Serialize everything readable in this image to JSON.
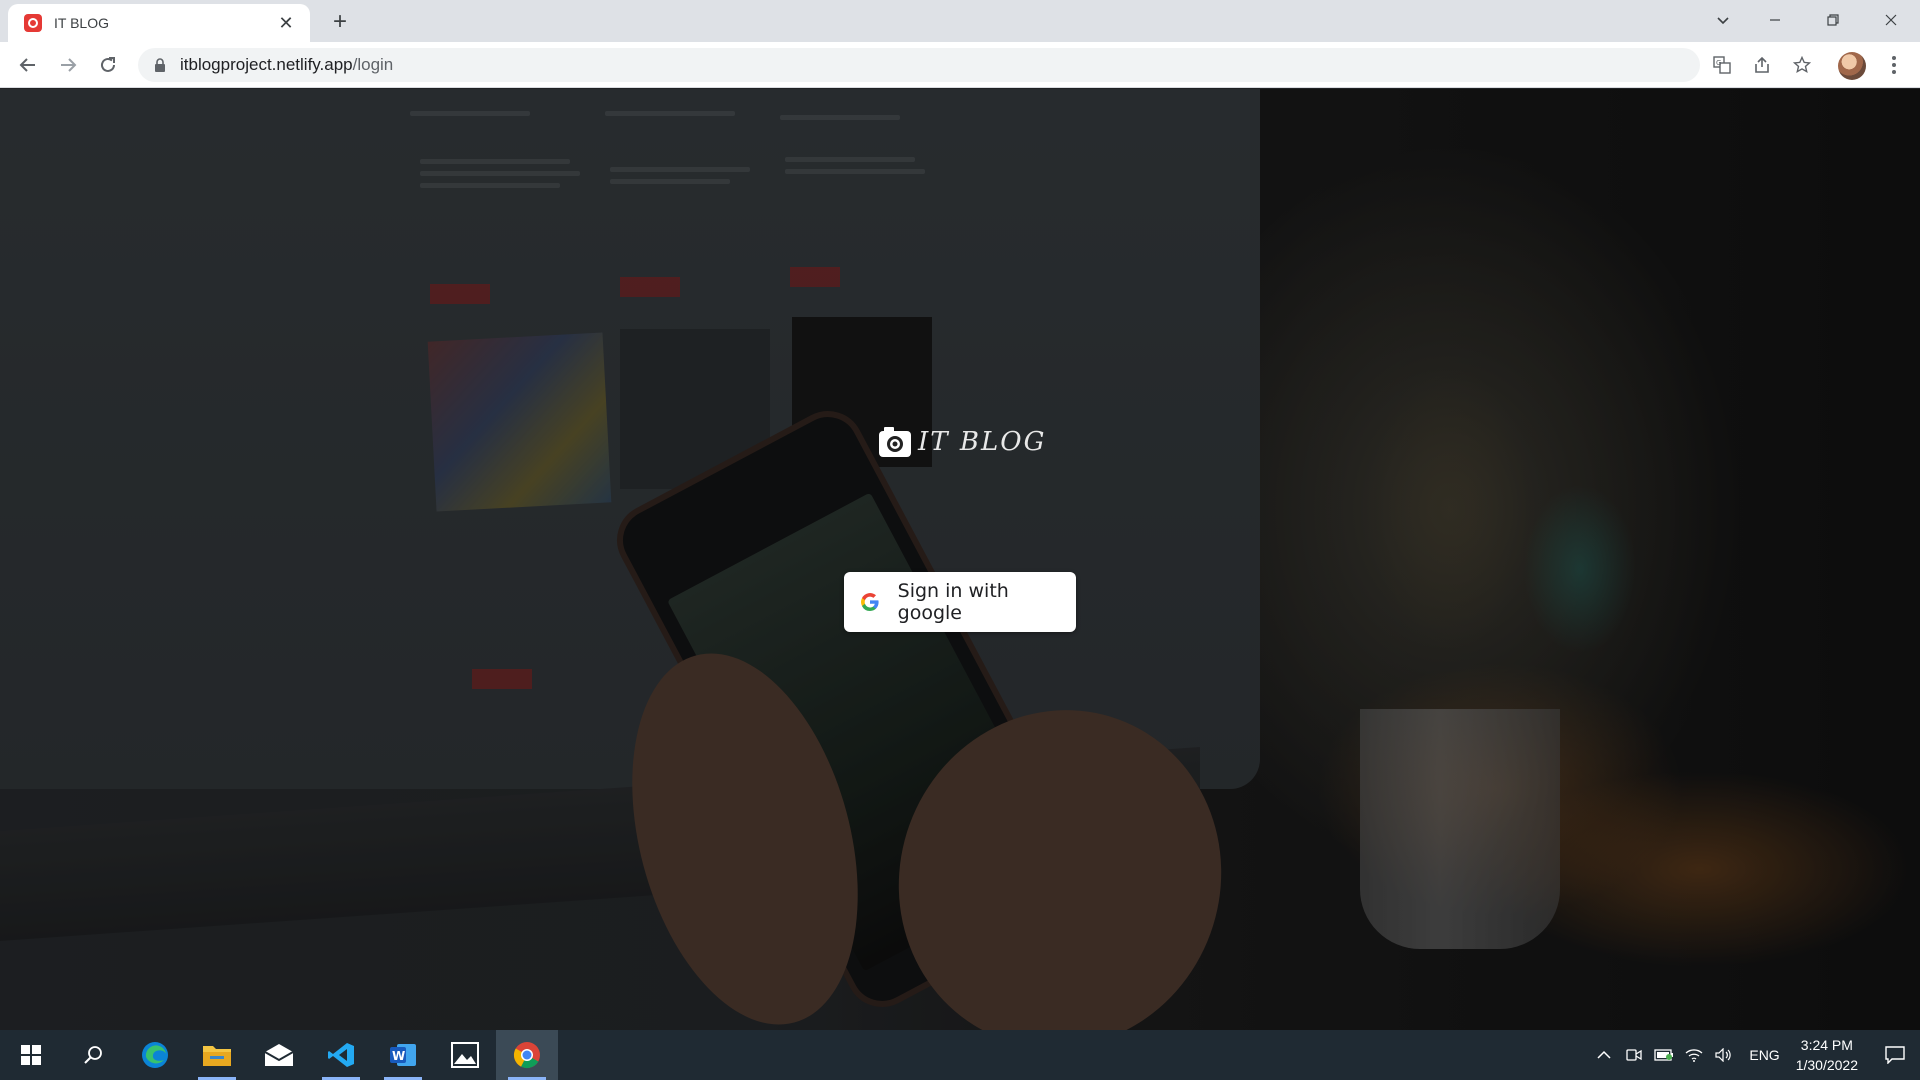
{
  "browser": {
    "tab": {
      "title": "IT BLOG",
      "favicon": "camera-icon"
    },
    "url": {
      "host": "itblogproject.netlify.app",
      "path": "/login"
    }
  },
  "page": {
    "brand_name": "IT BLOG",
    "signin_label": "Sign in with google"
  },
  "taskbar": {
    "apps": [
      "start",
      "search",
      "edge",
      "file-explorer",
      "mail",
      "vscode",
      "word",
      "photos",
      "chrome"
    ],
    "active_app": "chrome",
    "language": "ENG",
    "time": "3:24 PM",
    "date": "1/30/2022"
  },
  "colors": {
    "accent_red": "#e53935",
    "taskbar_bg": "#1f2a33",
    "chrome_active_indicator": "#8ab4f8"
  }
}
